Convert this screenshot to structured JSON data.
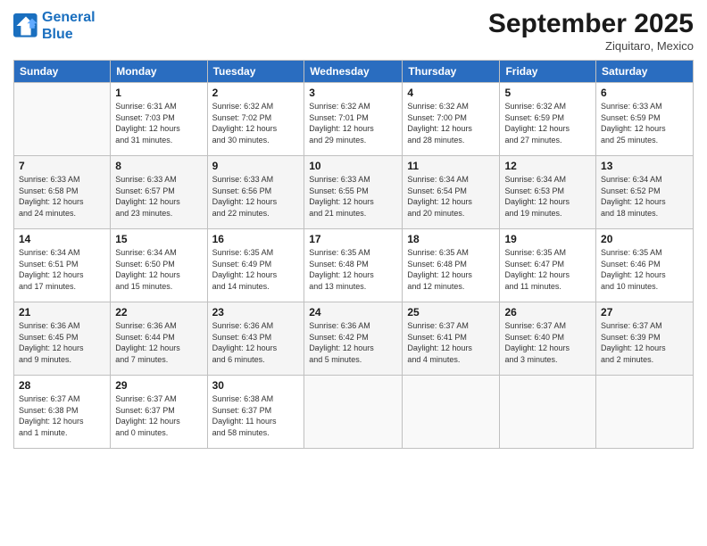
{
  "logo": {
    "line1": "General",
    "line2": "Blue"
  },
  "title": "September 2025",
  "subtitle": "Ziquitaro, Mexico",
  "days_header": [
    "Sunday",
    "Monday",
    "Tuesday",
    "Wednesday",
    "Thursday",
    "Friday",
    "Saturday"
  ],
  "weeks": [
    [
      {
        "num": "",
        "info": ""
      },
      {
        "num": "1",
        "info": "Sunrise: 6:31 AM\nSunset: 7:03 PM\nDaylight: 12 hours\nand 31 minutes."
      },
      {
        "num": "2",
        "info": "Sunrise: 6:32 AM\nSunset: 7:02 PM\nDaylight: 12 hours\nand 30 minutes."
      },
      {
        "num": "3",
        "info": "Sunrise: 6:32 AM\nSunset: 7:01 PM\nDaylight: 12 hours\nand 29 minutes."
      },
      {
        "num": "4",
        "info": "Sunrise: 6:32 AM\nSunset: 7:00 PM\nDaylight: 12 hours\nand 28 minutes."
      },
      {
        "num": "5",
        "info": "Sunrise: 6:32 AM\nSunset: 6:59 PM\nDaylight: 12 hours\nand 27 minutes."
      },
      {
        "num": "6",
        "info": "Sunrise: 6:33 AM\nSunset: 6:59 PM\nDaylight: 12 hours\nand 25 minutes."
      }
    ],
    [
      {
        "num": "7",
        "info": "Sunrise: 6:33 AM\nSunset: 6:58 PM\nDaylight: 12 hours\nand 24 minutes."
      },
      {
        "num": "8",
        "info": "Sunrise: 6:33 AM\nSunset: 6:57 PM\nDaylight: 12 hours\nand 23 minutes."
      },
      {
        "num": "9",
        "info": "Sunrise: 6:33 AM\nSunset: 6:56 PM\nDaylight: 12 hours\nand 22 minutes."
      },
      {
        "num": "10",
        "info": "Sunrise: 6:33 AM\nSunset: 6:55 PM\nDaylight: 12 hours\nand 21 minutes."
      },
      {
        "num": "11",
        "info": "Sunrise: 6:34 AM\nSunset: 6:54 PM\nDaylight: 12 hours\nand 20 minutes."
      },
      {
        "num": "12",
        "info": "Sunrise: 6:34 AM\nSunset: 6:53 PM\nDaylight: 12 hours\nand 19 minutes."
      },
      {
        "num": "13",
        "info": "Sunrise: 6:34 AM\nSunset: 6:52 PM\nDaylight: 12 hours\nand 18 minutes."
      }
    ],
    [
      {
        "num": "14",
        "info": "Sunrise: 6:34 AM\nSunset: 6:51 PM\nDaylight: 12 hours\nand 17 minutes."
      },
      {
        "num": "15",
        "info": "Sunrise: 6:34 AM\nSunset: 6:50 PM\nDaylight: 12 hours\nand 15 minutes."
      },
      {
        "num": "16",
        "info": "Sunrise: 6:35 AM\nSunset: 6:49 PM\nDaylight: 12 hours\nand 14 minutes."
      },
      {
        "num": "17",
        "info": "Sunrise: 6:35 AM\nSunset: 6:48 PM\nDaylight: 12 hours\nand 13 minutes."
      },
      {
        "num": "18",
        "info": "Sunrise: 6:35 AM\nSunset: 6:48 PM\nDaylight: 12 hours\nand 12 minutes."
      },
      {
        "num": "19",
        "info": "Sunrise: 6:35 AM\nSunset: 6:47 PM\nDaylight: 12 hours\nand 11 minutes."
      },
      {
        "num": "20",
        "info": "Sunrise: 6:35 AM\nSunset: 6:46 PM\nDaylight: 12 hours\nand 10 minutes."
      }
    ],
    [
      {
        "num": "21",
        "info": "Sunrise: 6:36 AM\nSunset: 6:45 PM\nDaylight: 12 hours\nand 9 minutes."
      },
      {
        "num": "22",
        "info": "Sunrise: 6:36 AM\nSunset: 6:44 PM\nDaylight: 12 hours\nand 7 minutes."
      },
      {
        "num": "23",
        "info": "Sunrise: 6:36 AM\nSunset: 6:43 PM\nDaylight: 12 hours\nand 6 minutes."
      },
      {
        "num": "24",
        "info": "Sunrise: 6:36 AM\nSunset: 6:42 PM\nDaylight: 12 hours\nand 5 minutes."
      },
      {
        "num": "25",
        "info": "Sunrise: 6:37 AM\nSunset: 6:41 PM\nDaylight: 12 hours\nand 4 minutes."
      },
      {
        "num": "26",
        "info": "Sunrise: 6:37 AM\nSunset: 6:40 PM\nDaylight: 12 hours\nand 3 minutes."
      },
      {
        "num": "27",
        "info": "Sunrise: 6:37 AM\nSunset: 6:39 PM\nDaylight: 12 hours\nand 2 minutes."
      }
    ],
    [
      {
        "num": "28",
        "info": "Sunrise: 6:37 AM\nSunset: 6:38 PM\nDaylight: 12 hours\nand 1 minute."
      },
      {
        "num": "29",
        "info": "Sunrise: 6:37 AM\nSunset: 6:37 PM\nDaylight: 12 hours\nand 0 minutes."
      },
      {
        "num": "30",
        "info": "Sunrise: 6:38 AM\nSunset: 6:37 PM\nDaylight: 11 hours\nand 58 minutes."
      },
      {
        "num": "",
        "info": ""
      },
      {
        "num": "",
        "info": ""
      },
      {
        "num": "",
        "info": ""
      },
      {
        "num": "",
        "info": ""
      }
    ]
  ]
}
